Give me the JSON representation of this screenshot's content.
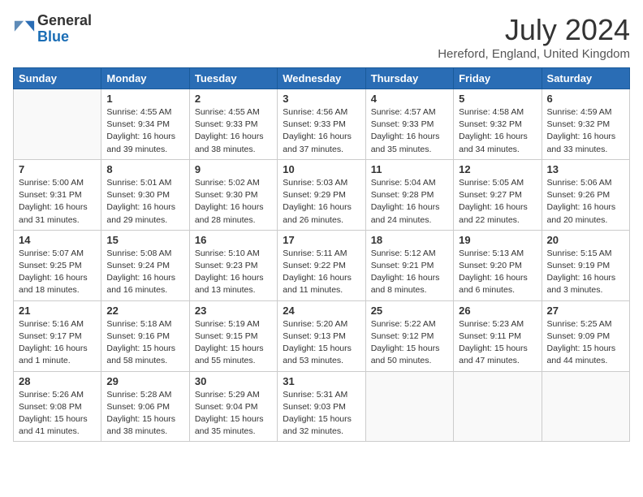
{
  "header": {
    "logo_line1": "General",
    "logo_line2": "Blue",
    "month_year": "July 2024",
    "location": "Hereford, England, United Kingdom"
  },
  "days_of_week": [
    "Sunday",
    "Monday",
    "Tuesday",
    "Wednesday",
    "Thursday",
    "Friday",
    "Saturday"
  ],
  "weeks": [
    [
      {
        "day": null
      },
      {
        "day": "1",
        "sunrise": "4:55 AM",
        "sunset": "9:34 PM",
        "daylight": "16 hours and 39 minutes."
      },
      {
        "day": "2",
        "sunrise": "4:55 AM",
        "sunset": "9:33 PM",
        "daylight": "16 hours and 38 minutes."
      },
      {
        "day": "3",
        "sunrise": "4:56 AM",
        "sunset": "9:33 PM",
        "daylight": "16 hours and 37 minutes."
      },
      {
        "day": "4",
        "sunrise": "4:57 AM",
        "sunset": "9:33 PM",
        "daylight": "16 hours and 35 minutes."
      },
      {
        "day": "5",
        "sunrise": "4:58 AM",
        "sunset": "9:32 PM",
        "daylight": "16 hours and 34 minutes."
      },
      {
        "day": "6",
        "sunrise": "4:59 AM",
        "sunset": "9:32 PM",
        "daylight": "16 hours and 33 minutes."
      }
    ],
    [
      {
        "day": "7",
        "sunrise": "5:00 AM",
        "sunset": "9:31 PM",
        "daylight": "16 hours and 31 minutes."
      },
      {
        "day": "8",
        "sunrise": "5:01 AM",
        "sunset": "9:30 PM",
        "daylight": "16 hours and 29 minutes."
      },
      {
        "day": "9",
        "sunrise": "5:02 AM",
        "sunset": "9:30 PM",
        "daylight": "16 hours and 28 minutes."
      },
      {
        "day": "10",
        "sunrise": "5:03 AM",
        "sunset": "9:29 PM",
        "daylight": "16 hours and 26 minutes."
      },
      {
        "day": "11",
        "sunrise": "5:04 AM",
        "sunset": "9:28 PM",
        "daylight": "16 hours and 24 minutes."
      },
      {
        "day": "12",
        "sunrise": "5:05 AM",
        "sunset": "9:27 PM",
        "daylight": "16 hours and 22 minutes."
      },
      {
        "day": "13",
        "sunrise": "5:06 AM",
        "sunset": "9:26 PM",
        "daylight": "16 hours and 20 minutes."
      }
    ],
    [
      {
        "day": "14",
        "sunrise": "5:07 AM",
        "sunset": "9:25 PM",
        "daylight": "16 hours and 18 minutes."
      },
      {
        "day": "15",
        "sunrise": "5:08 AM",
        "sunset": "9:24 PM",
        "daylight": "16 hours and 16 minutes."
      },
      {
        "day": "16",
        "sunrise": "5:10 AM",
        "sunset": "9:23 PM",
        "daylight": "16 hours and 13 minutes."
      },
      {
        "day": "17",
        "sunrise": "5:11 AM",
        "sunset": "9:22 PM",
        "daylight": "16 hours and 11 minutes."
      },
      {
        "day": "18",
        "sunrise": "5:12 AM",
        "sunset": "9:21 PM",
        "daylight": "16 hours and 8 minutes."
      },
      {
        "day": "19",
        "sunrise": "5:13 AM",
        "sunset": "9:20 PM",
        "daylight": "16 hours and 6 minutes."
      },
      {
        "day": "20",
        "sunrise": "5:15 AM",
        "sunset": "9:19 PM",
        "daylight": "16 hours and 3 minutes."
      }
    ],
    [
      {
        "day": "21",
        "sunrise": "5:16 AM",
        "sunset": "9:17 PM",
        "daylight": "16 hours and 1 minute."
      },
      {
        "day": "22",
        "sunrise": "5:18 AM",
        "sunset": "9:16 PM",
        "daylight": "15 hours and 58 minutes."
      },
      {
        "day": "23",
        "sunrise": "5:19 AM",
        "sunset": "9:15 PM",
        "daylight": "15 hours and 55 minutes."
      },
      {
        "day": "24",
        "sunrise": "5:20 AM",
        "sunset": "9:13 PM",
        "daylight": "15 hours and 53 minutes."
      },
      {
        "day": "25",
        "sunrise": "5:22 AM",
        "sunset": "9:12 PM",
        "daylight": "15 hours and 50 minutes."
      },
      {
        "day": "26",
        "sunrise": "5:23 AM",
        "sunset": "9:11 PM",
        "daylight": "15 hours and 47 minutes."
      },
      {
        "day": "27",
        "sunrise": "5:25 AM",
        "sunset": "9:09 PM",
        "daylight": "15 hours and 44 minutes."
      }
    ],
    [
      {
        "day": "28",
        "sunrise": "5:26 AM",
        "sunset": "9:08 PM",
        "daylight": "15 hours and 41 minutes."
      },
      {
        "day": "29",
        "sunrise": "5:28 AM",
        "sunset": "9:06 PM",
        "daylight": "15 hours and 38 minutes."
      },
      {
        "day": "30",
        "sunrise": "5:29 AM",
        "sunset": "9:04 PM",
        "daylight": "15 hours and 35 minutes."
      },
      {
        "day": "31",
        "sunrise": "5:31 AM",
        "sunset": "9:03 PM",
        "daylight": "15 hours and 32 minutes."
      },
      {
        "day": null
      },
      {
        "day": null
      },
      {
        "day": null
      }
    ]
  ]
}
